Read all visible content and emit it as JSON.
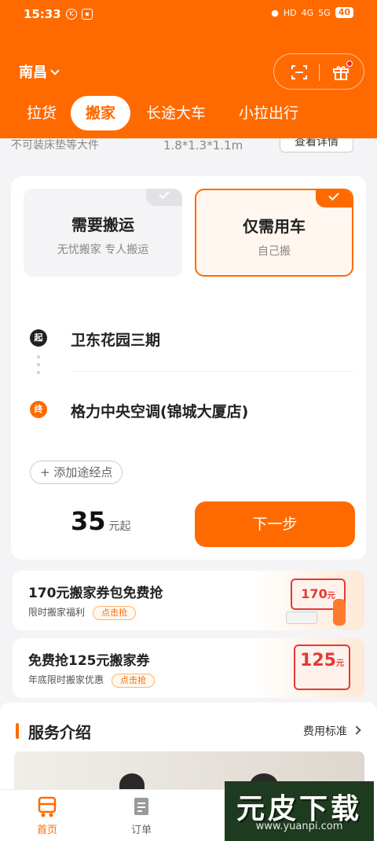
{
  "status_bar": {
    "time": "15:33",
    "battery": "40",
    "signal_labels": [
      "HD",
      "4G",
      "5G"
    ]
  },
  "header": {
    "city": "南昌",
    "tabs": [
      {
        "label": "拉货",
        "active": false
      },
      {
        "label": "搬家",
        "active": true
      },
      {
        "label": "长途大车",
        "active": false
      },
      {
        "label": "小拉出行",
        "active": false
      }
    ],
    "icons": [
      "scan-icon",
      "gift-icon"
    ]
  },
  "partial_strip": {
    "note": "不可装床垫等大件",
    "size": "1.8*1.3*1.1m",
    "button": "查看详情"
  },
  "service_mode": {
    "options": [
      {
        "title": "需要搬运",
        "subtitle": "无忧搬家 专人搬运",
        "selected": false
      },
      {
        "title": "仅需用车",
        "subtitle": "自己搬",
        "selected": true
      }
    ]
  },
  "route": {
    "start_badge": "起",
    "start": "卫东花园三期",
    "end_badge": "终",
    "end": "格力中央空调(锦城大厦店)",
    "add_stop": "+ 添加途经点"
  },
  "order": {
    "price": "35",
    "price_unit": "元起",
    "next_button": "下一步"
  },
  "promos": [
    {
      "title": "170元搬家券包免费抢",
      "subtitle": "限时搬家福利",
      "tag": "点击抢",
      "art_value": "170",
      "art_unit": "元"
    },
    {
      "title": "免费抢125元搬家券",
      "subtitle": "年底限时搬家优惠",
      "tag": "点击抢",
      "art_value": "125",
      "art_unit": "元"
    }
  ],
  "service": {
    "title": "服务介绍",
    "link": "费用标准"
  },
  "bottom_nav": {
    "items": [
      {
        "label": "首页",
        "active": true
      },
      {
        "label": "订单",
        "active": false
      }
    ]
  },
  "watermark": {
    "logo": "元皮下载",
    "url": "www.yuanpi.com"
  },
  "colors": {
    "brand": "#ff6a00",
    "background": "#f4f4f6"
  }
}
